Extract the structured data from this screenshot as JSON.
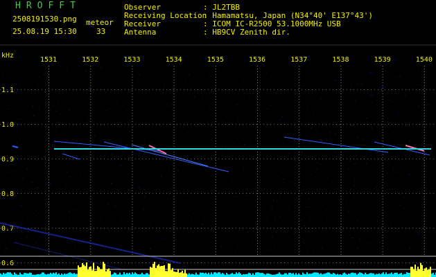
{
  "header": {
    "program": "HROFFT",
    "filename": "2508191530.png",
    "mode_label": "meteor",
    "datetime": "25.08.19 15:30",
    "count": "33",
    "fields": [
      {
        "label": "Observer",
        "value": ": JL2TBB"
      },
      {
        "label": "Receiving Location",
        "value": ": Hamamatsu, Japan (N34°40' E137°43')"
      },
      {
        "label": "Receiver",
        "value": ": ICOM IC-R2500 53.1000MHz USB"
      },
      {
        "label": "Antenna",
        "value": ": HB9CV Zenith dir."
      }
    ]
  },
  "colors": {
    "header_green": "#3cd23c",
    "header_yellow": "#f5f000",
    "background": "#000000",
    "noise_blue": "#2030c0",
    "carrier_line": "#30d8e0",
    "meteor_pink": "#ff70b0",
    "level_cyan": "#00e8ff",
    "level_yellow": "#ffff30"
  },
  "axes": {
    "y_unit": "kHz",
    "y_ticks": [
      "1.1",
      "1.0",
      "0.9",
      "0.8",
      "0.7",
      "0.6"
    ],
    "x_ticks": [
      "1531",
      "1532",
      "1533",
      "1534",
      "1535",
      "1536",
      "1537",
      "1538",
      "1539",
      "1540"
    ]
  }
}
